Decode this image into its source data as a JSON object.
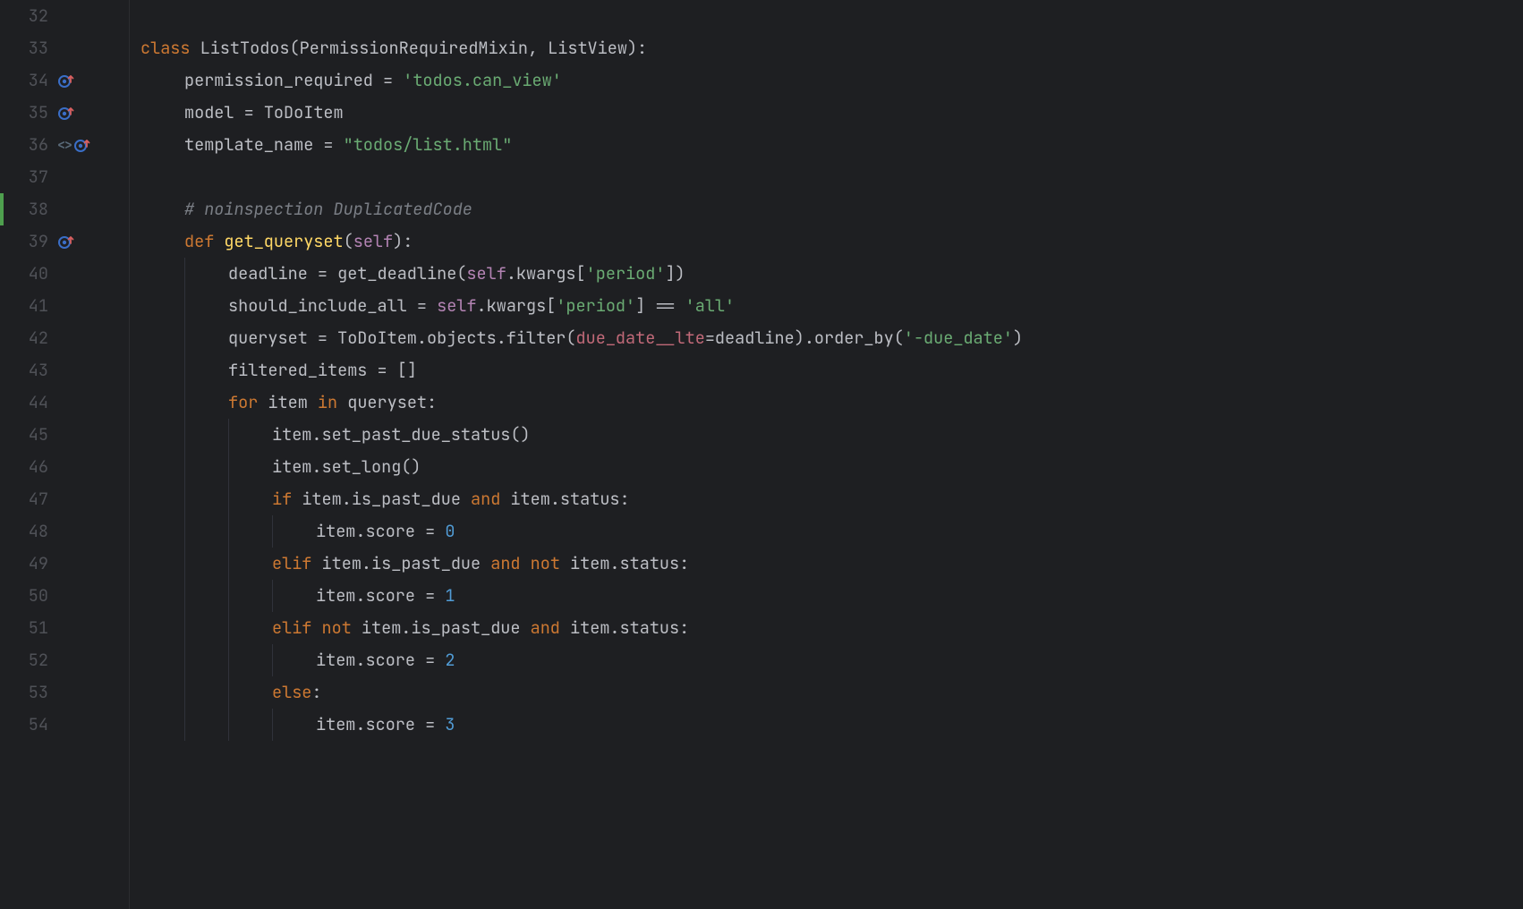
{
  "lines": [
    {
      "num": 32,
      "gutter": {},
      "tokens": []
    },
    {
      "num": 33,
      "gutter": {},
      "tokens": [
        {
          "cls": "kw",
          "t": "class "
        },
        {
          "cls": "cls",
          "t": "ListTodos("
        },
        {
          "cls": "id",
          "t": "PermissionRequiredMixin"
        },
        {
          "cls": "op",
          "t": ", "
        },
        {
          "cls": "id",
          "t": "ListView"
        },
        {
          "cls": "op",
          "t": "):"
        }
      ]
    },
    {
      "num": 34,
      "gutter": {
        "override": true
      },
      "indent": 1,
      "tokens": [
        {
          "cls": "id",
          "t": "permission_required "
        },
        {
          "cls": "op",
          "t": "= "
        },
        {
          "cls": "str",
          "t": "'todos.can_view'"
        }
      ]
    },
    {
      "num": 35,
      "gutter": {
        "override": true
      },
      "indent": 1,
      "tokens": [
        {
          "cls": "id",
          "t": "model "
        },
        {
          "cls": "op",
          "t": "= "
        },
        {
          "cls": "id",
          "t": "ToDoItem"
        }
      ]
    },
    {
      "num": 36,
      "gutter": {
        "angle": true,
        "override": true
      },
      "indent": 1,
      "tokens": [
        {
          "cls": "id",
          "t": "template_name "
        },
        {
          "cls": "op",
          "t": "= "
        },
        {
          "cls": "str",
          "t": "\"todos/list.html\""
        }
      ]
    },
    {
      "num": 37,
      "gutter": {},
      "indent": 0,
      "tokens": []
    },
    {
      "num": 38,
      "gutter": {
        "marker": true
      },
      "indent": 1,
      "tokens": [
        {
          "cls": "cmt",
          "t": "# noinspection DuplicatedCode"
        }
      ]
    },
    {
      "num": 39,
      "gutter": {
        "override": true
      },
      "indent": 1,
      "tokens": [
        {
          "cls": "kw",
          "t": "def "
        },
        {
          "cls": "fn",
          "t": "get_queryset"
        },
        {
          "cls": "op",
          "t": "("
        },
        {
          "cls": "self",
          "t": "self"
        },
        {
          "cls": "op",
          "t": "):"
        }
      ]
    },
    {
      "num": 40,
      "gutter": {},
      "indent": 2,
      "guide1": true,
      "tokens": [
        {
          "cls": "id",
          "t": "deadline "
        },
        {
          "cls": "op",
          "t": "= "
        },
        {
          "cls": "id",
          "t": "get_deadline("
        },
        {
          "cls": "self",
          "t": "self"
        },
        {
          "cls": "op",
          "t": ".kwargs["
        },
        {
          "cls": "str",
          "t": "'period'"
        },
        {
          "cls": "op",
          "t": "])"
        }
      ]
    },
    {
      "num": 41,
      "gutter": {},
      "indent": 2,
      "guide1": true,
      "tokens": [
        {
          "cls": "id",
          "t": "should_include_all "
        },
        {
          "cls": "op",
          "t": "= "
        },
        {
          "cls": "self",
          "t": "self"
        },
        {
          "cls": "op",
          "t": ".kwargs["
        },
        {
          "cls": "str",
          "t": "'period'"
        },
        {
          "cls": "op",
          "t": "] == "
        },
        {
          "cls": "str",
          "t": "'all'"
        }
      ]
    },
    {
      "num": 42,
      "gutter": {},
      "indent": 2,
      "guide1": true,
      "tokens": [
        {
          "cls": "id",
          "t": "queryset "
        },
        {
          "cls": "op",
          "t": "= "
        },
        {
          "cls": "id",
          "t": "ToDoItem.objects.filter("
        },
        {
          "cls": "param",
          "t": "due_date__lte"
        },
        {
          "cls": "op",
          "t": "=deadline).order_by("
        },
        {
          "cls": "str",
          "t": "'-due_date'"
        },
        {
          "cls": "op",
          "t": ")"
        }
      ]
    },
    {
      "num": 43,
      "gutter": {},
      "indent": 2,
      "guide1": true,
      "tokens": [
        {
          "cls": "id",
          "t": "filtered_items "
        },
        {
          "cls": "op",
          "t": "= []"
        }
      ]
    },
    {
      "num": 44,
      "gutter": {},
      "indent": 2,
      "guide1": true,
      "tokens": [
        {
          "cls": "kw",
          "t": "for "
        },
        {
          "cls": "id",
          "t": "item "
        },
        {
          "cls": "kw",
          "t": "in "
        },
        {
          "cls": "id",
          "t": "queryset:"
        }
      ]
    },
    {
      "num": 45,
      "gutter": {},
      "indent": 3,
      "guide1": true,
      "guide2": true,
      "tokens": [
        {
          "cls": "id",
          "t": "item.set_past_due_status()"
        }
      ]
    },
    {
      "num": 46,
      "gutter": {},
      "indent": 3,
      "guide1": true,
      "guide2": true,
      "tokens": [
        {
          "cls": "id",
          "t": "item.set_long()"
        }
      ]
    },
    {
      "num": 47,
      "gutter": {},
      "indent": 3,
      "guide1": true,
      "guide2": true,
      "tokens": [
        {
          "cls": "kw",
          "t": "if "
        },
        {
          "cls": "id",
          "t": "item.is_past_due "
        },
        {
          "cls": "kw",
          "t": "and "
        },
        {
          "cls": "id",
          "t": "item.status:"
        }
      ]
    },
    {
      "num": 48,
      "gutter": {},
      "indent": 4,
      "guide1": true,
      "guide2": true,
      "guide3": true,
      "tokens": [
        {
          "cls": "id",
          "t": "item.score "
        },
        {
          "cls": "op",
          "t": "= "
        },
        {
          "cls": "num",
          "t": "0"
        }
      ]
    },
    {
      "num": 49,
      "gutter": {},
      "indent": 3,
      "guide1": true,
      "guide2": true,
      "tokens": [
        {
          "cls": "kw",
          "t": "elif "
        },
        {
          "cls": "id",
          "t": "item.is_past_due "
        },
        {
          "cls": "kw",
          "t": "and not "
        },
        {
          "cls": "id",
          "t": "item.status:"
        }
      ]
    },
    {
      "num": 50,
      "gutter": {},
      "indent": 4,
      "guide1": true,
      "guide2": true,
      "guide3": true,
      "tokens": [
        {
          "cls": "id",
          "t": "item.score "
        },
        {
          "cls": "op",
          "t": "= "
        },
        {
          "cls": "num",
          "t": "1"
        }
      ]
    },
    {
      "num": 51,
      "gutter": {},
      "indent": 3,
      "guide1": true,
      "guide2": true,
      "tokens": [
        {
          "cls": "kw",
          "t": "elif not "
        },
        {
          "cls": "id",
          "t": "item.is_past_due "
        },
        {
          "cls": "kw",
          "t": "and "
        },
        {
          "cls": "id",
          "t": "item.status:"
        }
      ]
    },
    {
      "num": 52,
      "gutter": {},
      "indent": 4,
      "guide1": true,
      "guide2": true,
      "guide3": true,
      "tokens": [
        {
          "cls": "id",
          "t": "item.score "
        },
        {
          "cls": "op",
          "t": "= "
        },
        {
          "cls": "num",
          "t": "2"
        }
      ]
    },
    {
      "num": 53,
      "gutter": {},
      "indent": 3,
      "guide1": true,
      "guide2": true,
      "tokens": [
        {
          "cls": "kw",
          "t": "else"
        },
        {
          "cls": "op",
          "t": ":"
        }
      ]
    },
    {
      "num": 54,
      "gutter": {},
      "indent": 4,
      "guide1": true,
      "guide2": true,
      "guide3": true,
      "tokens": [
        {
          "cls": "id",
          "t": "item.score "
        },
        {
          "cls": "op",
          "t": "= "
        },
        {
          "cls": "num",
          "t": "3"
        }
      ]
    }
  ],
  "icons": {
    "angle_brackets": "<>"
  }
}
